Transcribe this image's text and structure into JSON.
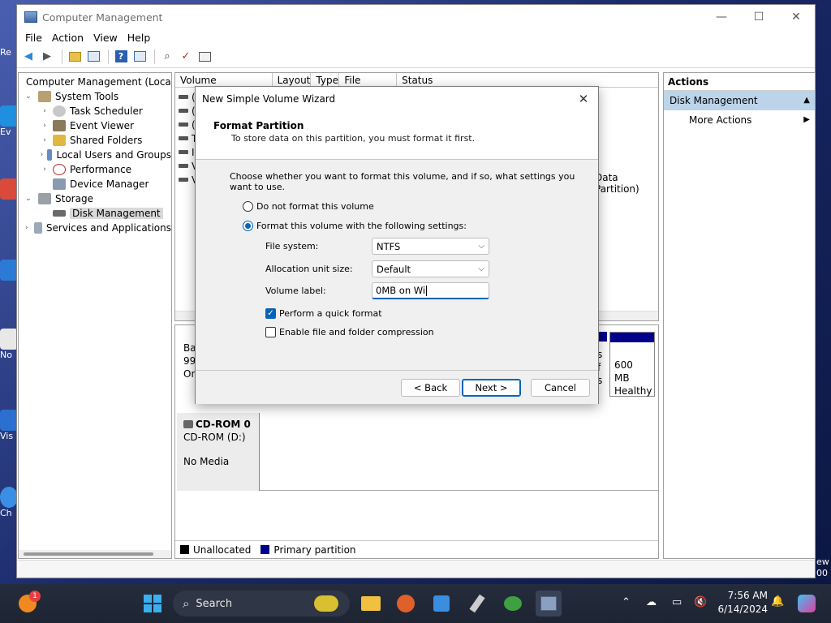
{
  "window": {
    "title": "Computer Management",
    "controls": {
      "minimize": "—",
      "maximize": "☐",
      "close": "✕"
    }
  },
  "menu": [
    "File",
    "Action",
    "View",
    "Help"
  ],
  "tree": {
    "root": "Computer Management (Local",
    "items": [
      {
        "label": "System Tools",
        "level": 1,
        "expanded": true
      },
      {
        "label": "Task Scheduler",
        "level": 2
      },
      {
        "label": "Event Viewer",
        "level": 2
      },
      {
        "label": "Shared Folders",
        "level": 2
      },
      {
        "label": "Local Users and Groups",
        "level": 2
      },
      {
        "label": "Performance",
        "level": 2
      },
      {
        "label": "Device Manager",
        "level": 2
      },
      {
        "label": "Storage",
        "level": 1,
        "expanded": true
      },
      {
        "label": "Disk Management",
        "level": 2,
        "selected": true
      },
      {
        "label": "Services and Applications",
        "level": 1
      }
    ]
  },
  "volume_list": {
    "columns": [
      "Volume",
      "Layout",
      "Type",
      "File System",
      "Status"
    ],
    "row_fragments": [
      "(",
      "(",
      "(",
      "T",
      "I",
      "V",
      "V"
    ],
    "partial_status": "Data Partition)"
  },
  "disks": {
    "disk0_fragments": [
      "Bas",
      "99.",
      "On"
    ],
    "partial_part_text": [
      "s",
      "f",
      "s"
    ],
    "right_part": {
      "size": "600 MB",
      "status": "Healthy"
    },
    "cdrom": {
      "title": "CD-ROM 0",
      "drive": "CD-ROM (D:)",
      "media": "No Media"
    }
  },
  "legend": [
    {
      "label": "Unallocated",
      "color": "#000000"
    },
    {
      "label": "Primary partition",
      "color": "#00008b"
    }
  ],
  "actions": {
    "header": "Actions",
    "section": "Disk Management",
    "items": [
      "More Actions"
    ]
  },
  "dialog": {
    "title": "New Simple Volume Wizard",
    "close": "✕",
    "heading": "Format Partition",
    "subheading": "To store data on this partition, you must format it first.",
    "instruction": "Choose whether you want to format this volume, and if so, what settings you want to use.",
    "radio_no_format": "Do not format this volume",
    "radio_format": "Format this volume with the following settings:",
    "file_system_label": "File system:",
    "file_system_value": "NTFS",
    "alloc_label": "Allocation unit size:",
    "alloc_value": "Default",
    "volume_label_label": "Volume label:",
    "volume_label_value": "0MB on Wi",
    "quick_format": "Perform a quick format",
    "quick_format_checked": true,
    "compression": "Enable file and folder compression",
    "compression_checked": false,
    "back": "< Back",
    "next": "Next >",
    "cancel": "Cancel"
  },
  "desktop_fragments": [
    "Re",
    "Ev",
    "No",
    "Vis",
    "Ch"
  ],
  "desktop_right_fragments": [
    "ew",
    "00"
  ],
  "taskbar": {
    "search_placeholder": "Search",
    "notification_count": "1",
    "time": "7:56 AM",
    "date": "6/14/2024"
  }
}
